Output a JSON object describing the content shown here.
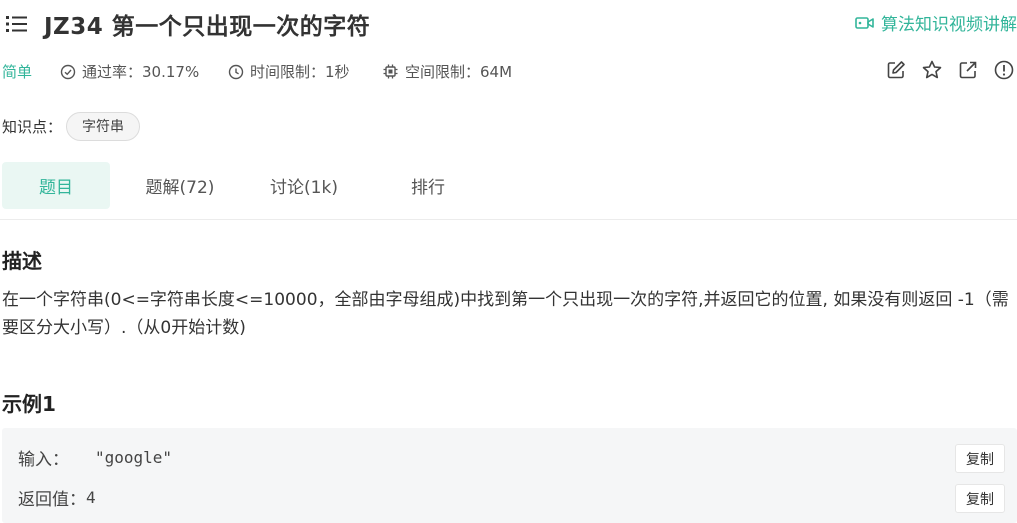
{
  "header": {
    "title": "JZ34  第一个只出现一次的字符",
    "video_link": "算法知识视频讲解"
  },
  "meta": {
    "difficulty": "简单",
    "pass_rate": "通过率：30.17%",
    "time_limit": "时间限制：1秒",
    "space_limit": "空间限制：64M"
  },
  "knowledge": {
    "label": "知识点：",
    "tags": [
      "字符串"
    ]
  },
  "tabs": [
    "题目",
    "题解(72)",
    "讨论(1k)",
    "排行"
  ],
  "description": {
    "heading": "描述",
    "text": "在一个字符串(0<=字符串长度<=10000，全部由字母组成)中找到第一个只出现一次的字符,并返回它的位置, 如果没有则返回 -1（需要区分大小写）.（从0开始计数)"
  },
  "example": {
    "heading": "示例1",
    "input_label": "输入：",
    "input_value": "\"google\"",
    "output_label": "返回值：",
    "output_value": "4",
    "copy_label": "复制"
  },
  "colors": {
    "accent": "#32b59a",
    "tab_active_bg": "#eaf7f3",
    "example_bg": "#f5f6f7"
  }
}
